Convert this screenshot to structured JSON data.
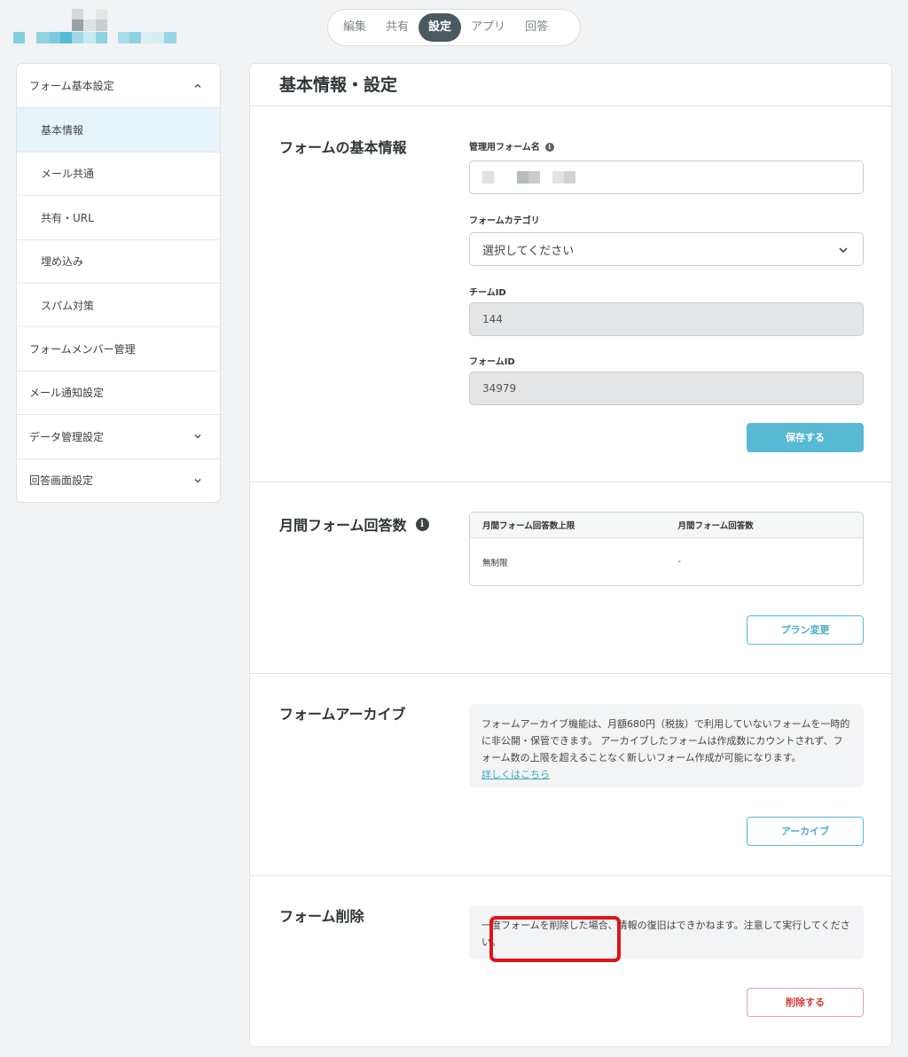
{
  "nav": {
    "tabs": [
      {
        "label": "編集"
      },
      {
        "label": "共有"
      },
      {
        "label": "設定",
        "active": true
      },
      {
        "label": "アプリ"
      },
      {
        "label": "回答"
      }
    ]
  },
  "sidebar": {
    "items": [
      {
        "label": "フォーム基本設定",
        "type": "group",
        "expanded": true
      },
      {
        "label": "基本情報",
        "type": "sub",
        "selected": true
      },
      {
        "label": "メール共通",
        "type": "sub"
      },
      {
        "label": "共有・URL",
        "type": "sub"
      },
      {
        "label": "埋め込み",
        "type": "sub"
      },
      {
        "label": "スパム対策",
        "type": "sub"
      },
      {
        "label": "フォームメンバー管理",
        "type": "item"
      },
      {
        "label": "メール通知設定",
        "type": "item"
      },
      {
        "label": "データ管理設定",
        "type": "group",
        "expanded": false
      },
      {
        "label": "回答画面設定",
        "type": "group",
        "expanded": false
      }
    ]
  },
  "main": {
    "title": "基本情報・設定",
    "basic": {
      "title": "フォームの基本情報",
      "form_name_label": "管理用フォーム名",
      "category_label": "フォームカテゴリ",
      "category_value": "選択してください",
      "team_id_label": "チームID",
      "team_id_value": "144",
      "form_id_label": "フォームID",
      "form_id_value": "34979",
      "save_label": "保存する"
    },
    "monthly": {
      "title": "月間フォーム回答数",
      "col1": "月間フォーム回答数上限",
      "col2": "月間フォーム回答数",
      "val1": "無制限",
      "val2": "-",
      "plan_button": "プラン変更"
    },
    "archive": {
      "title": "フォームアーカイブ",
      "text": "フォームアーカイブ機能は、月額680円（税抜）で利用していないフォームを一時的に非公開・保管できます。 アーカイブしたフォームは作成数にカウントされず、フォーム数の上限を超えることなく新しいフォーム作成が可能になります。",
      "link": "詳しくはこちら",
      "button": "アーカイブ"
    },
    "delete": {
      "title": "フォーム削除",
      "text": "一度フォームを削除した場合、情報の復旧はできかねます。注意して実行してください。",
      "button": "削除する"
    }
  },
  "colors": {
    "accent": "#57b9d4",
    "danger": "#d43a32",
    "highlight_frame": "#e0131a",
    "active_tab": "#4b5a60"
  }
}
